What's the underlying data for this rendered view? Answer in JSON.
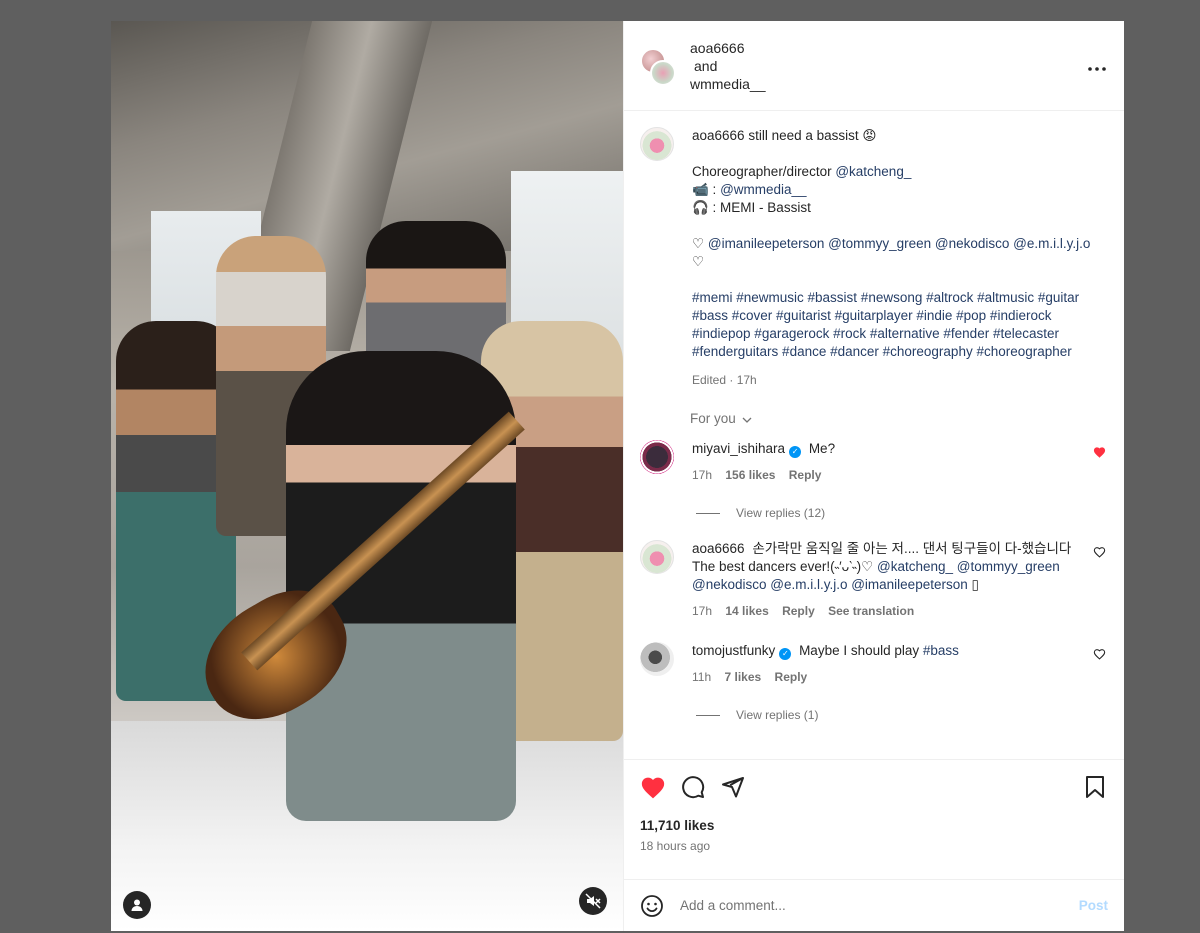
{
  "header": {
    "user1": "aoa6666",
    "and": "and",
    "user2": "wmmedia__"
  },
  "caption": {
    "username": "aoa6666",
    "text": "still need a bassist 😡",
    "line1_prefix": "Choreographer/director ",
    "line1_link": "@katcheng_",
    "line2_prefix": "📹 : ",
    "line2_link": "@wmmedia__",
    "line3": "🎧 : MEMI - Bassist",
    "mentions_prefix": "♡ ",
    "mentions": "@imanileepeterson @tommyy_green @nekodisco @e.m.i.l.y.j.o",
    "mentions_suffix": "♡",
    "hashtags": "#memi #newmusic #bassist #newsong #altrock #altmusic #guitar #bass #cover #guitarist #guitarplayer #indie #pop #indierock #indiepop #garagerock #rock #alternative #fender #telecaster #fenderguitars #dance #dancer #choreography #choreographer",
    "meta": "Edited · 17h"
  },
  "for_you": "For you",
  "comments": [
    {
      "username": "miyavi_ishihara",
      "verified": true,
      "text": "Me?",
      "time": "17h",
      "likes": "156 likes",
      "reply": "Reply",
      "liked": true,
      "view_replies": "View replies (12)"
    },
    {
      "username": "aoa6666",
      "verified": false,
      "text": "손가락만 움직일 줄 아는 저.... 댄서 팅구들이 다-했습니다 The best dancers ever!(˵′ᴗ‵˵)♡",
      "mentions": "@katcheng_ @tommyy_green @nekodisco @e.m.i.l.y.j.o @imanileepeterson",
      "trail": " ▯",
      "time": "17h",
      "likes": "14 likes",
      "reply": "Reply",
      "translation": "See translation"
    },
    {
      "username": "tomojustfunky",
      "verified": true,
      "text": "Maybe I should play ",
      "tag": "#bass",
      "time": "11h",
      "likes": "7 likes",
      "reply": "Reply",
      "view_replies": "View replies (1)"
    }
  ],
  "actions": {
    "likes": "11,710 likes",
    "time": "18 hours ago"
  },
  "add_comment": {
    "placeholder": "Add a comment...",
    "post": "Post"
  },
  "colors": {
    "accent": "#0095f6",
    "like_red": "#ff3040",
    "link": "#263e66"
  }
}
